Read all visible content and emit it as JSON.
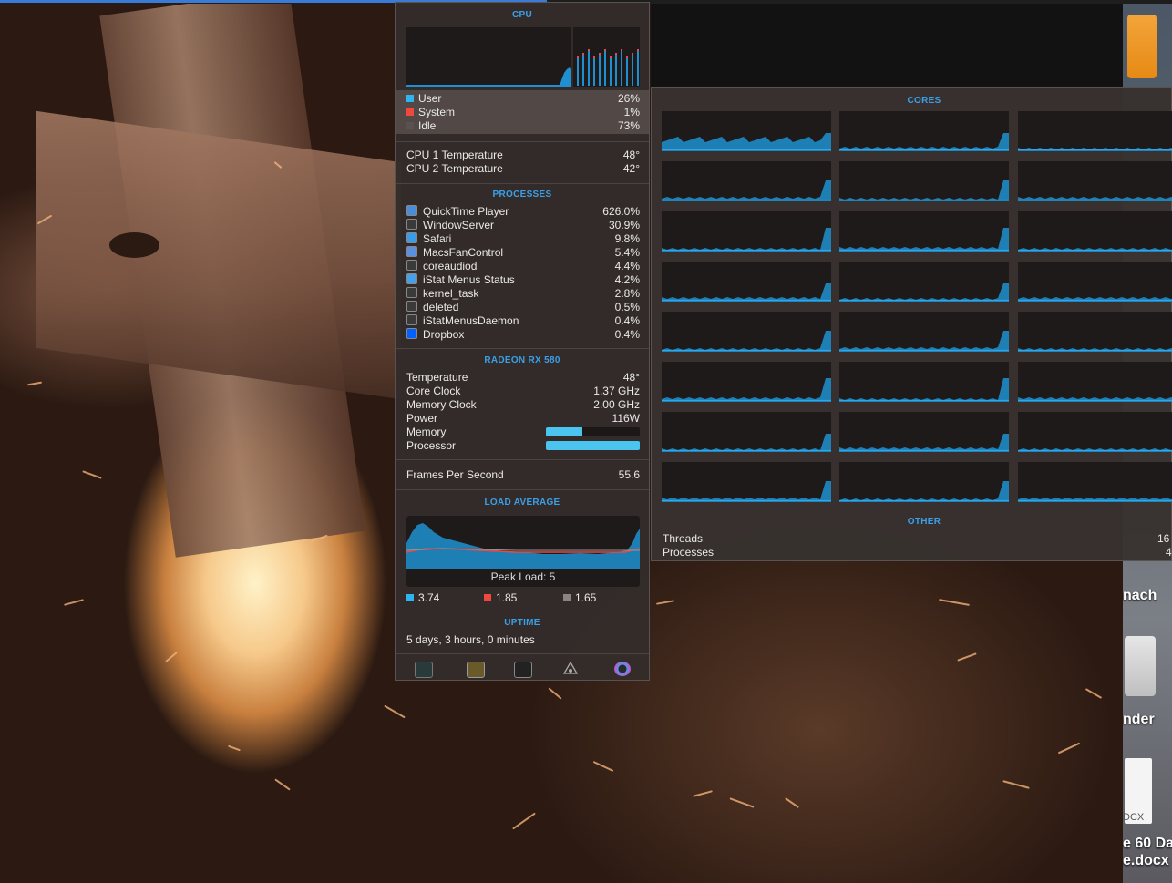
{
  "desktop": {
    "labels": [
      "nach",
      "nder",
      "e 60 Da",
      "e.docx"
    ],
    "doc_ext": "DCX"
  },
  "cpu": {
    "title": "CPU",
    "user_label": "User",
    "user_value": "26%",
    "system_label": "System",
    "system_value": "1%",
    "idle_label": "Idle",
    "idle_value": "73%",
    "colors": {
      "user": "#2fb4f0",
      "system": "#f0483e",
      "idle": "#5a5250"
    },
    "temp1_label": "CPU 1 Temperature",
    "temp1_value": "48°",
    "temp2_label": "CPU 2 Temperature",
    "temp2_value": "42°"
  },
  "processes": {
    "title": "PROCESSES",
    "items": [
      {
        "name": "QuickTime Player",
        "value": "626.0%",
        "icon": "quicktime-icon"
      },
      {
        "name": "WindowServer",
        "value": "30.9%",
        "icon": "terminal-icon"
      },
      {
        "name": "Safari",
        "value": "9.8%",
        "icon": "safari-icon"
      },
      {
        "name": "MacsFanControl",
        "value": "5.4%",
        "icon": "fan-icon"
      },
      {
        "name": "coreaudiod",
        "value": "4.4%",
        "icon": "terminal-icon"
      },
      {
        "name": "iStat Menus Status",
        "value": "4.2%",
        "icon": "istat-icon"
      },
      {
        "name": "kernel_task",
        "value": "2.8%",
        "icon": "terminal-icon"
      },
      {
        "name": "deleted",
        "value": "0.5%",
        "icon": "terminal-icon"
      },
      {
        "name": "iStatMenusDaemon",
        "value": "0.4%",
        "icon": "terminal-icon"
      },
      {
        "name": "Dropbox",
        "value": "0.4%",
        "icon": "dropbox-icon"
      }
    ]
  },
  "gpu": {
    "title": "RADEON RX 580",
    "temperature_label": "Temperature",
    "temperature_value": "48°",
    "core_clock_label": "Core Clock",
    "core_clock_value": "1.37 GHz",
    "memory_clock_label": "Memory Clock",
    "memory_clock_value": "2.00 GHz",
    "power_label": "Power",
    "power_value": "116W",
    "memory_label": "Memory",
    "memory_fraction": 0.39,
    "processor_label": "Processor",
    "processor_fraction": 1.0,
    "fps_label": "Frames Per Second",
    "fps_value": "55.6"
  },
  "load": {
    "title": "LOAD AVERAGE",
    "peak_label": "Peak Load: 5",
    "one": "3.74",
    "five": "1.85",
    "fifteen": "1.65",
    "colors": {
      "one": "#2fb4f0",
      "five": "#f0483e",
      "fifteen": "#8a8482"
    }
  },
  "uptime": {
    "title": "UPTIME",
    "value": "5 days, 3 hours, 0 minutes"
  },
  "toolbar": {
    "icons": [
      "activity-monitor-icon",
      "system-report-icon",
      "console-icon",
      "disk-utility-icon",
      "istat-settings-icon"
    ]
  },
  "cores": {
    "title": "CORES"
  },
  "other": {
    "title": "OTHER",
    "threads_label": "Threads",
    "threads_value": "16",
    "processes_label": "Processes",
    "processes_value": "4"
  }
}
